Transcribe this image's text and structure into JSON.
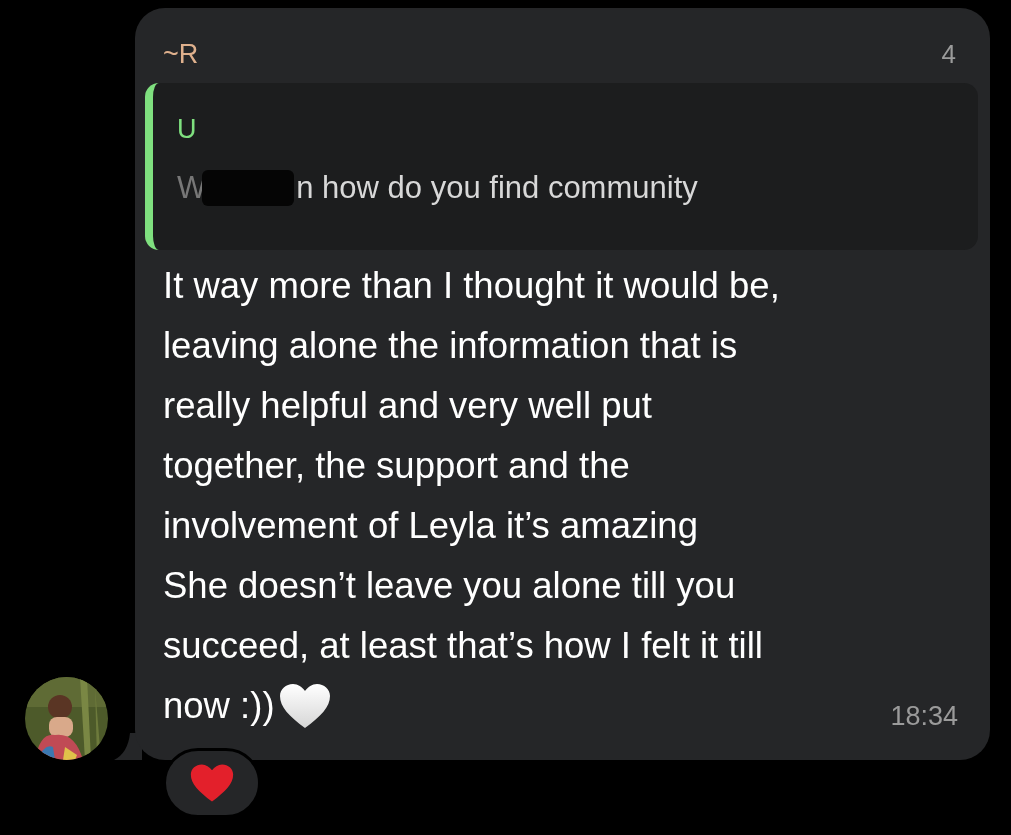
{
  "message": {
    "sender": "~R",
    "sender_number_tail": "4",
    "quote": {
      "sender": "U",
      "text_start": "W",
      "text": "n how do you find community"
    },
    "body": "It way more than I thought it would be,\nleaving alone the information that is\nreally helpful and very well put\ntogether, the support and the\ninvolvement of Leyla it’s amazing\nShe doesn’t leave you alone till you\nsucceed, at least that’s how I felt it till\nnow :))",
    "time": "18:34",
    "reactions": [
      {
        "kind": "red-heart"
      }
    ]
  }
}
